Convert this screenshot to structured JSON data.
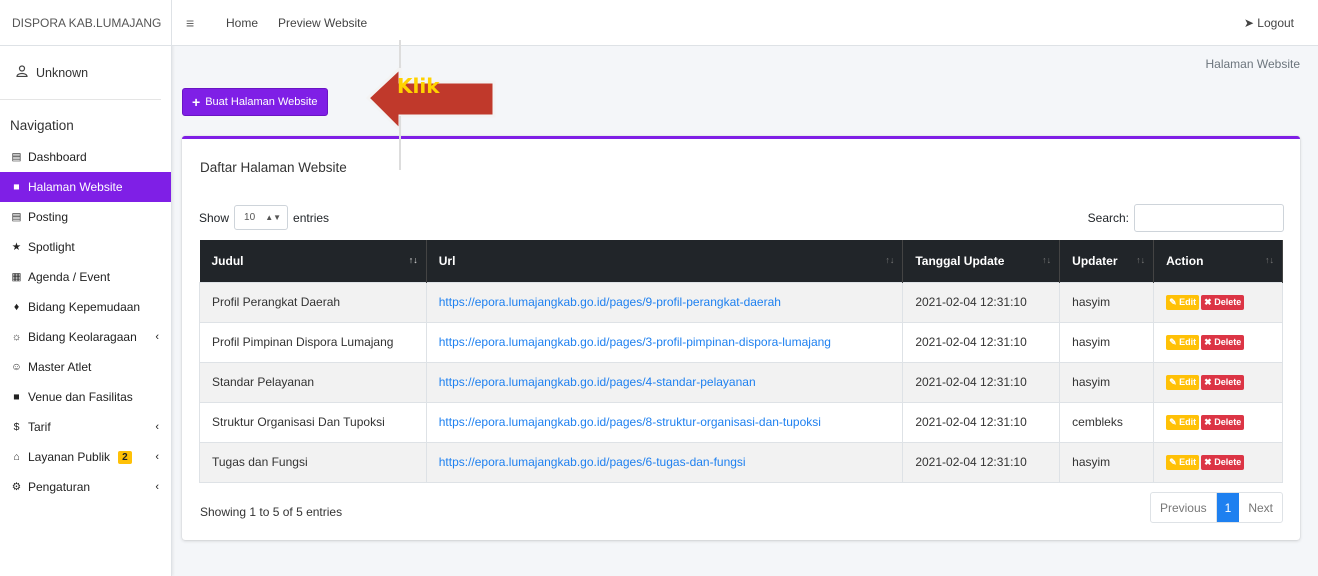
{
  "brand": "DISPORA KAB.LUMAJANG",
  "user": {
    "name": "Unknown"
  },
  "sidebar": {
    "header": "Navigation",
    "items": [
      {
        "label": "Dashboard",
        "icon": "dashboard-icon"
      },
      {
        "label": "Halaman Website",
        "icon": "page-icon",
        "active": true
      },
      {
        "label": "Posting",
        "icon": "news-icon"
      },
      {
        "label": "Spotlight",
        "icon": "spotlight-icon"
      },
      {
        "label": "Agenda / Event",
        "icon": "calendar-icon"
      },
      {
        "label": "Bidang Kepemudaan",
        "icon": "graduation-icon"
      },
      {
        "label": "Bidang Keolaragaan",
        "icon": "sport-icon",
        "caret": true
      },
      {
        "label": "Master Atlet",
        "icon": "user-icon"
      },
      {
        "label": "Venue dan Fasilitas",
        "icon": "venue-icon"
      },
      {
        "label": "Tarif",
        "icon": "dollar-icon",
        "caret": true
      },
      {
        "label": "Layanan Publik",
        "icon": "service-icon",
        "badge": "2",
        "caret": true
      },
      {
        "label": "Pengaturan",
        "icon": "settings-icon",
        "caret": true
      }
    ]
  },
  "topnav": {
    "home": "Home",
    "preview": "Preview Website",
    "logout": "Logout"
  },
  "breadcrumb": "Halaman Website",
  "create_button": "Buat Halaman Website",
  "annotation": "Klik",
  "card": {
    "title": "Daftar Halaman Website",
    "show_label": "Show",
    "entries_value": "10",
    "entries_label": "entries",
    "search_label": "Search:"
  },
  "table": {
    "headers": [
      "Judul",
      "Url",
      "Tanggal Update",
      "Updater",
      "Action"
    ],
    "rows": [
      {
        "judul": "Profil Perangkat Daerah",
        "url": "https://epora.lumajangkab.go.id/pages/9-profil-perangkat-daerah",
        "tanggal": "2021-02-04 12:31:10",
        "updater": "hasyim"
      },
      {
        "judul": "Profil Pimpinan Dispora Lumajang",
        "url": "https://epora.lumajangkab.go.id/pages/3-profil-pimpinan-dispora-lumajang",
        "tanggal": "2021-02-04 12:31:10",
        "updater": "hasyim"
      },
      {
        "judul": "Standar Pelayanan",
        "url": "https://epora.lumajangkab.go.id/pages/4-standar-pelayanan",
        "tanggal": "2021-02-04 12:31:10",
        "updater": "hasyim"
      },
      {
        "judul": "Struktur Organisasi Dan Tupoksi",
        "url": "https://epora.lumajangkab.go.id/pages/8-struktur-organisasi-dan-tupoksi",
        "tanggal": "2021-02-04 12:31:10",
        "updater": "cembleks"
      },
      {
        "judul": "Tugas dan Fungsi",
        "url": "https://epora.lumajangkab.go.id/pages/6-tugas-dan-fungsi",
        "tanggal": "2021-02-04 12:31:10",
        "updater": "hasyim"
      }
    ],
    "edit_label": "Edit",
    "delete_label": "Delete"
  },
  "footer": {
    "info": "Showing 1 to 5 of 5 entries",
    "previous": "Previous",
    "current_page": "1",
    "next": "Next"
  },
  "colors": {
    "accent": "#7f1fe6",
    "link": "#1e80f0",
    "warning": "#ffc107",
    "danger": "#dc3545",
    "annotation_arrow": "#c0392b"
  }
}
